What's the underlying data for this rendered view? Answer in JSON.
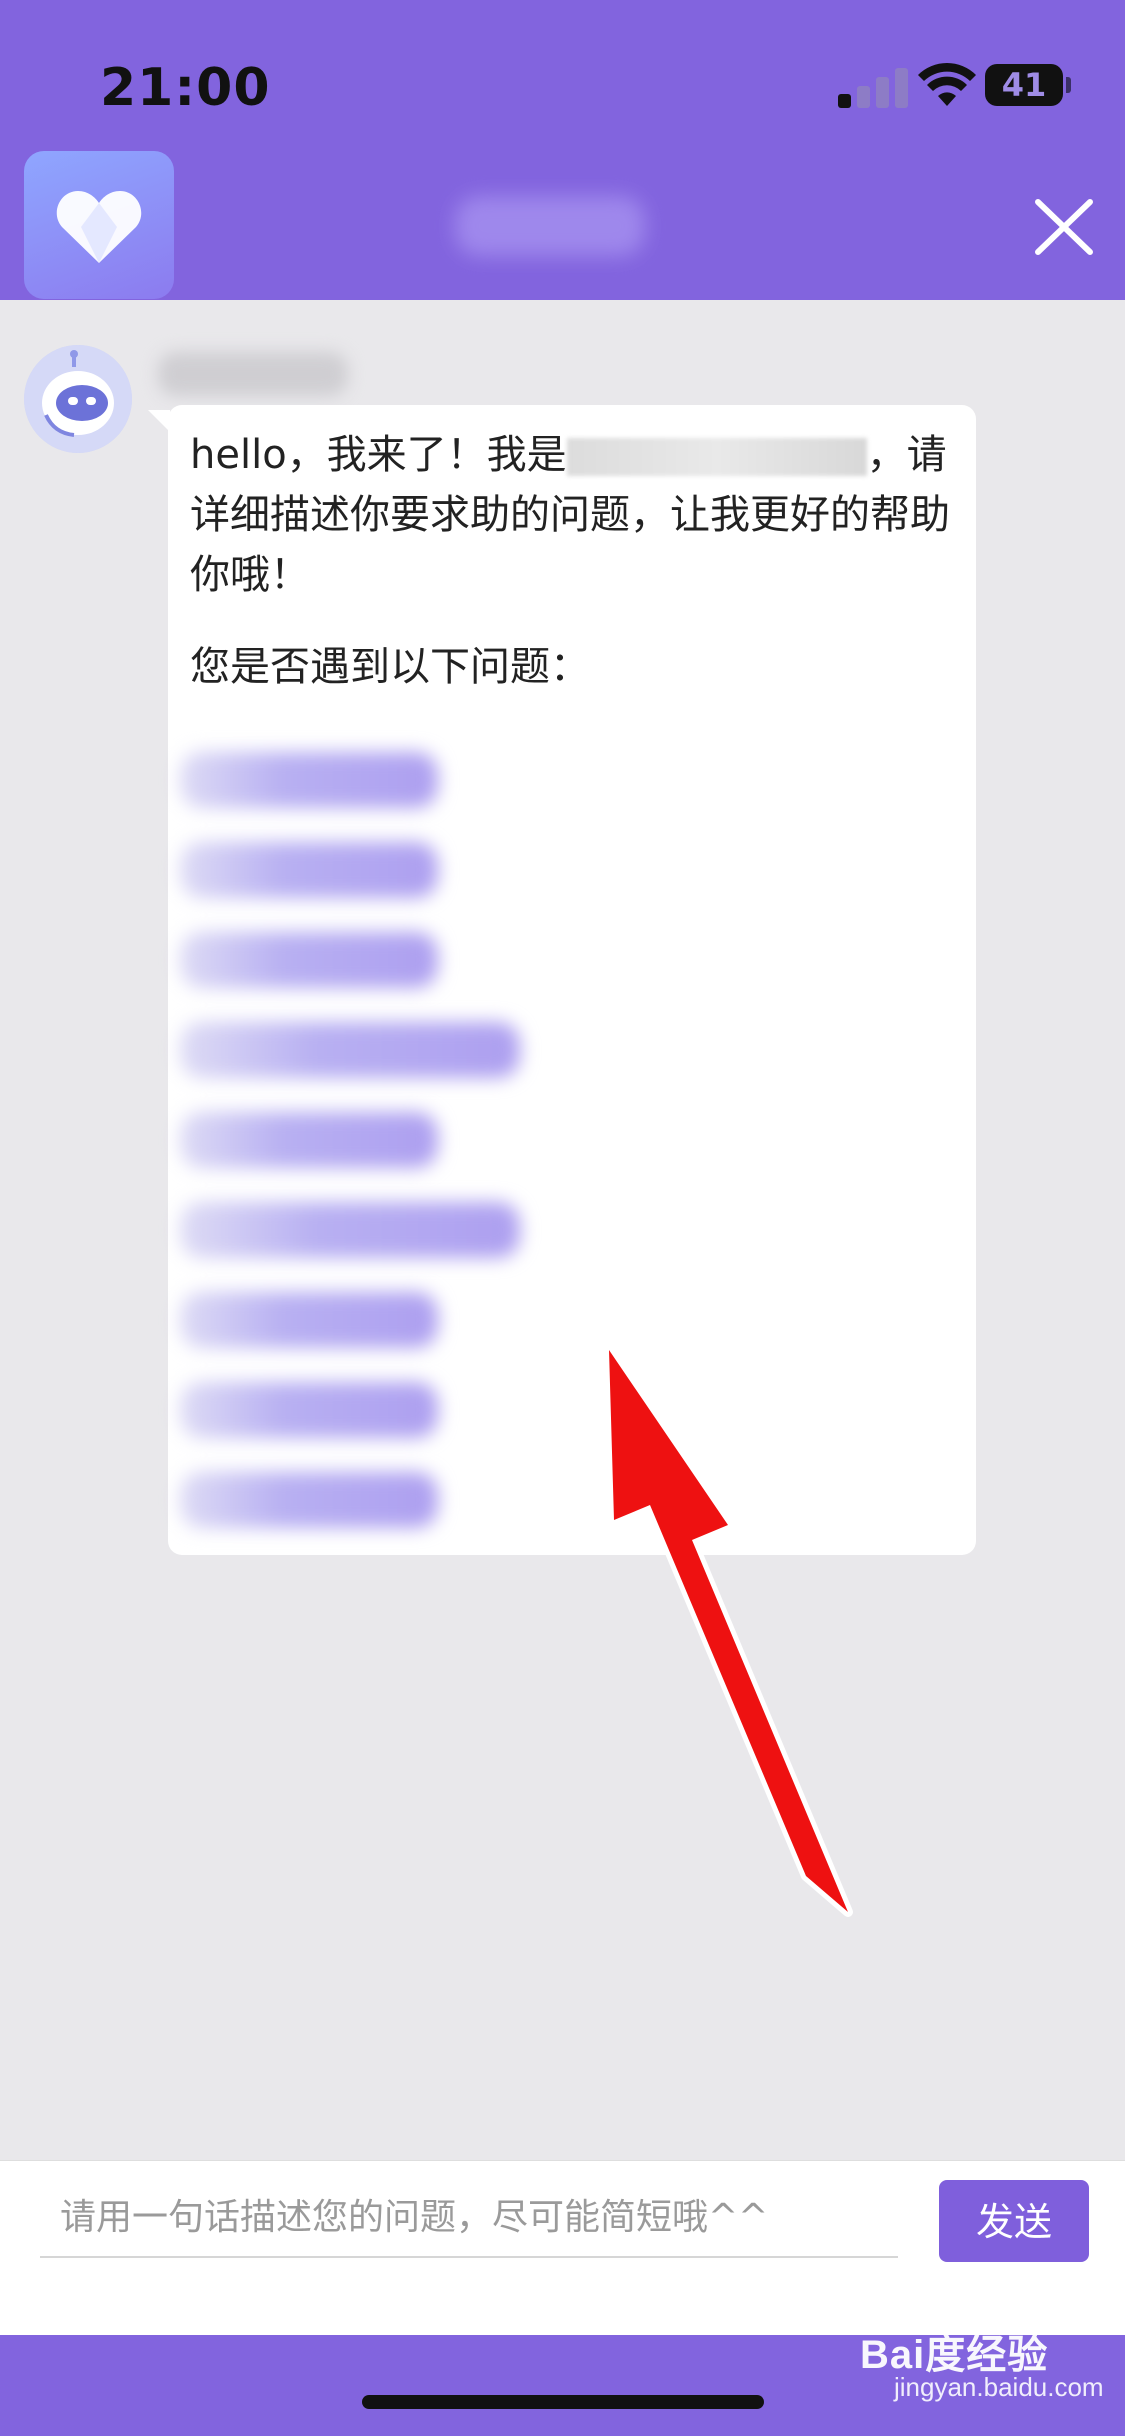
{
  "status_bar": {
    "time": "21:00",
    "battery": "41"
  },
  "header": {
    "close_icon": "close-icon",
    "logo_icon": "heart-icon"
  },
  "chat": {
    "message": {
      "greeting_prefix": "hello，我来了！我是",
      "greeting_suffix": "，请详细描述你要求助的问题，让我更好的帮助你哦！",
      "question": "您是否遇到以下问题："
    }
  },
  "composer": {
    "placeholder": "请用一句话描述您的问题，尽可能简短哦^^",
    "send_label": "发送"
  },
  "watermark": {
    "brand": "Bai度经验",
    "url": "jingyan.baidu.com"
  },
  "colors": {
    "brand_purple": "#8264de",
    "send_button": "#7f5fdc",
    "annotation_arrow": "#ee1111"
  }
}
